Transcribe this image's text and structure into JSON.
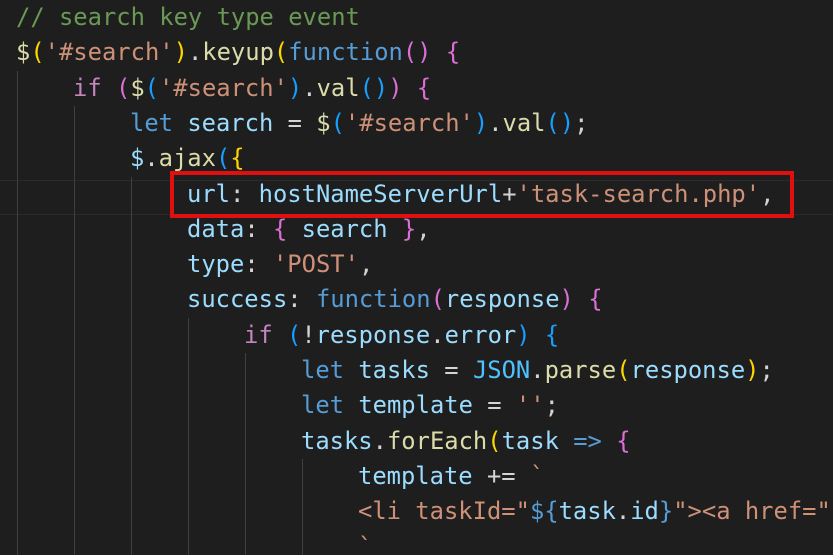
{
  "editor": {
    "theme_colors": {
      "background": "#1e1e1e",
      "comment": "#6a9955",
      "function": "#dcdcaa",
      "string": "#ce9178",
      "keyword": "#569cd6",
      "control": "#c586c0",
      "variable": "#9cdcfe",
      "highlight_box": "#e01010"
    },
    "lines": [
      {
        "tokens": [
          {
            "text": "// search key type event",
            "cls": "c-comment"
          }
        ]
      },
      {
        "tokens": [
          {
            "text": "$",
            "cls": "c-fn"
          },
          {
            "text": "(",
            "cls": "b1"
          },
          {
            "text": "'#search'",
            "cls": "c-str"
          },
          {
            "text": ")",
            "cls": "b1"
          },
          {
            "text": ".",
            "cls": "c-punc"
          },
          {
            "text": "keyup",
            "cls": "c-fn"
          },
          {
            "text": "(",
            "cls": "b1"
          },
          {
            "text": "function",
            "cls": "c-kw"
          },
          {
            "text": "()",
            "cls": "b2"
          },
          {
            "text": " ",
            "cls": "c-punc"
          },
          {
            "text": "{",
            "cls": "b2"
          }
        ]
      },
      {
        "tokens": [
          {
            "text": "if",
            "cls": "c-ctl"
          },
          {
            "text": " ",
            "cls": "c-punc"
          },
          {
            "text": "(",
            "cls": "b2"
          },
          {
            "text": "$",
            "cls": "c-fn"
          },
          {
            "text": "(",
            "cls": "b3"
          },
          {
            "text": "'#search'",
            "cls": "c-str"
          },
          {
            "text": ")",
            "cls": "b3"
          },
          {
            "text": ".",
            "cls": "c-punc"
          },
          {
            "text": "val",
            "cls": "c-fn"
          },
          {
            "text": "()",
            "cls": "b3"
          },
          {
            "text": ")",
            "cls": "b2"
          },
          {
            "text": " ",
            "cls": "c-punc"
          },
          {
            "text": "{",
            "cls": "b2"
          }
        ]
      },
      {
        "tokens": [
          {
            "text": "let",
            "cls": "c-kw"
          },
          {
            "text": " ",
            "cls": "c-punc"
          },
          {
            "text": "search",
            "cls": "c-var"
          },
          {
            "text": " = ",
            "cls": "c-punc"
          },
          {
            "text": "$",
            "cls": "c-fn"
          },
          {
            "text": "(",
            "cls": "b3"
          },
          {
            "text": "'#search'",
            "cls": "c-str"
          },
          {
            "text": ")",
            "cls": "b3"
          },
          {
            "text": ".",
            "cls": "c-punc"
          },
          {
            "text": "val",
            "cls": "c-fn"
          },
          {
            "text": "()",
            "cls": "b3"
          },
          {
            "text": ";",
            "cls": "c-punc"
          }
        ]
      },
      {
        "tokens": [
          {
            "text": "$",
            "cls": "c-var"
          },
          {
            "text": ".",
            "cls": "c-punc"
          },
          {
            "text": "ajax",
            "cls": "c-fn"
          },
          {
            "text": "(",
            "cls": "b3"
          },
          {
            "text": "{",
            "cls": "b1"
          }
        ]
      },
      {
        "tokens": [
          {
            "text": "url",
            "cls": "c-var"
          },
          {
            "text": ": ",
            "cls": "c-punc"
          },
          {
            "text": "hostNameServerUrl",
            "cls": "c-var"
          },
          {
            "text": "+",
            "cls": "c-punc"
          },
          {
            "text": "'task-search.php'",
            "cls": "c-str"
          },
          {
            "text": ",",
            "cls": "c-punc"
          }
        ]
      },
      {
        "tokens": [
          {
            "text": "data",
            "cls": "c-var"
          },
          {
            "text": ": ",
            "cls": "c-punc"
          },
          {
            "text": "{",
            "cls": "b2"
          },
          {
            "text": " ",
            "cls": "c-punc"
          },
          {
            "text": "search",
            "cls": "c-var"
          },
          {
            "text": " ",
            "cls": "c-punc"
          },
          {
            "text": "}",
            "cls": "b2"
          },
          {
            "text": ",",
            "cls": "c-punc"
          }
        ]
      },
      {
        "tokens": [
          {
            "text": "type",
            "cls": "c-var"
          },
          {
            "text": ": ",
            "cls": "c-punc"
          },
          {
            "text": "'POST'",
            "cls": "c-str"
          },
          {
            "text": ",",
            "cls": "c-punc"
          }
        ]
      },
      {
        "tokens": [
          {
            "text": "success",
            "cls": "c-var"
          },
          {
            "text": ": ",
            "cls": "c-punc"
          },
          {
            "text": "function",
            "cls": "c-kw"
          },
          {
            "text": "(",
            "cls": "b2"
          },
          {
            "text": "response",
            "cls": "c-var"
          },
          {
            "text": ")",
            "cls": "b2"
          },
          {
            "text": " ",
            "cls": "c-punc"
          },
          {
            "text": "{",
            "cls": "b2"
          }
        ]
      },
      {
        "tokens": [
          {
            "text": "if",
            "cls": "c-ctl"
          },
          {
            "text": " ",
            "cls": "c-punc"
          },
          {
            "text": "(",
            "cls": "b3"
          },
          {
            "text": "!",
            "cls": "c-punc"
          },
          {
            "text": "response",
            "cls": "c-var"
          },
          {
            "text": ".",
            "cls": "c-punc"
          },
          {
            "text": "error",
            "cls": "c-var"
          },
          {
            "text": ")",
            "cls": "b3"
          },
          {
            "text": " ",
            "cls": "c-punc"
          },
          {
            "text": "{",
            "cls": "b3"
          }
        ]
      },
      {
        "tokens": [
          {
            "text": "let",
            "cls": "c-kw"
          },
          {
            "text": " ",
            "cls": "c-punc"
          },
          {
            "text": "tasks",
            "cls": "c-var"
          },
          {
            "text": " = ",
            "cls": "c-punc"
          },
          {
            "text": "JSON",
            "cls": "c-cst"
          },
          {
            "text": ".",
            "cls": "c-punc"
          },
          {
            "text": "parse",
            "cls": "c-fn"
          },
          {
            "text": "(",
            "cls": "b1"
          },
          {
            "text": "response",
            "cls": "c-var"
          },
          {
            "text": ")",
            "cls": "b1"
          },
          {
            "text": ";",
            "cls": "c-punc"
          }
        ]
      },
      {
        "tokens": [
          {
            "text": "let",
            "cls": "c-kw"
          },
          {
            "text": " ",
            "cls": "c-punc"
          },
          {
            "text": "template",
            "cls": "c-var"
          },
          {
            "text": " = ",
            "cls": "c-punc"
          },
          {
            "text": "''",
            "cls": "c-str"
          },
          {
            "text": ";",
            "cls": "c-punc"
          }
        ]
      },
      {
        "tokens": [
          {
            "text": "tasks",
            "cls": "c-var"
          },
          {
            "text": ".",
            "cls": "c-punc"
          },
          {
            "text": "forEach",
            "cls": "c-fn"
          },
          {
            "text": "(",
            "cls": "b1"
          },
          {
            "text": "task",
            "cls": "c-var"
          },
          {
            "text": " ",
            "cls": "c-punc"
          },
          {
            "text": "=>",
            "cls": "c-kw"
          },
          {
            "text": " ",
            "cls": "c-punc"
          },
          {
            "text": "{",
            "cls": "b2"
          }
        ]
      },
      {
        "tokens": [
          {
            "text": "template",
            "cls": "c-var"
          },
          {
            "text": " += ",
            "cls": "c-punc"
          },
          {
            "text": "`",
            "cls": "c-str"
          }
        ]
      },
      {
        "tokens": [
          {
            "text": "<li taskId=\"",
            "cls": "c-str"
          },
          {
            "text": "${",
            "cls": "c-kw"
          },
          {
            "text": "task",
            "cls": "c-var"
          },
          {
            "text": ".",
            "cls": "c-punc"
          },
          {
            "text": "id",
            "cls": "c-var"
          },
          {
            "text": "}",
            "cls": "c-kw"
          },
          {
            "text": "\"><a href=\"$",
            "cls": "c-str"
          }
        ]
      },
      {
        "tokens": [
          {
            "text": "`",
            "cls": "c-str"
          }
        ]
      }
    ]
  }
}
